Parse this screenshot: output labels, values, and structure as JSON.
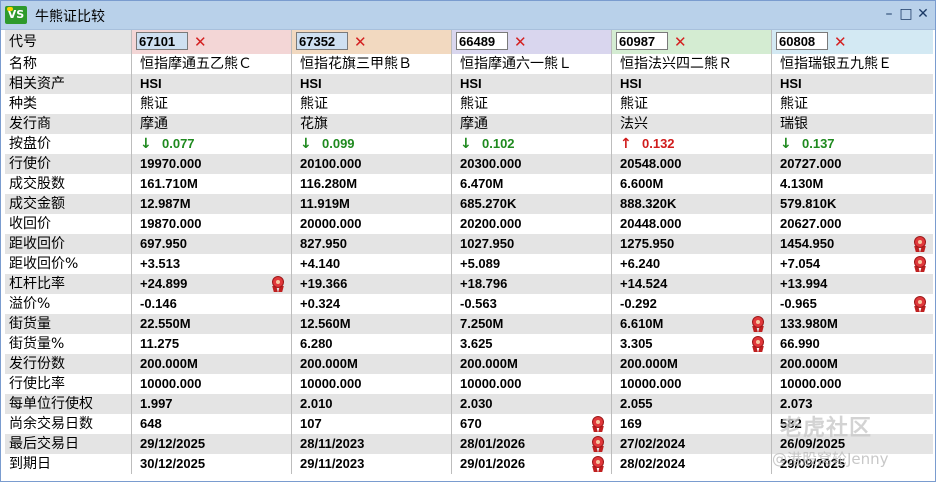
{
  "window": {
    "title": "牛熊证比较",
    "app_icon": "VS"
  },
  "labels": [
    "名称",
    "相关资产",
    "种类",
    "发行商",
    "按盘价",
    "行使价",
    "成交股数",
    "成交金额",
    "收回价",
    "距收回价",
    "距收回价%",
    "杠杆比率",
    "溢价%",
    "街货量",
    "街货量%",
    "发行份数",
    "行使比率",
    "每单位行使权",
    "尚余交易日数",
    "最后交易日",
    "到期日"
  ],
  "header_label": "代号",
  "colors": {
    "col0": "#f3d6d6",
    "col1": "#f2d9c0",
    "col2": "#d9d6ee",
    "col3": "#d4ecd2",
    "col4": "#d3e9f3"
  },
  "products": [
    {
      "code": "67101",
      "name": "恒指摩通五乙熊Ｃ",
      "asset": "HSI",
      "type": "熊证",
      "issuer": "摩通",
      "price": "0.077",
      "dir": "down",
      "vals": [
        "19970.000",
        "161.710M",
        "12.987M",
        "19870.000",
        "697.950",
        "+3.513",
        "+24.899",
        "-0.146",
        "22.550M",
        "11.275",
        "200.000M",
        "10000.000",
        "1.997",
        "648",
        "29/12/2025",
        "30/12/2025"
      ],
      "medals": [
        6
      ]
    },
    {
      "code": "67352",
      "name": "恒指花旗三甲熊Ｂ",
      "asset": "HSI",
      "type": "熊证",
      "issuer": "花旗",
      "price": "0.099",
      "dir": "down",
      "vals": [
        "20100.000",
        "116.280M",
        "11.919M",
        "20000.000",
        "827.950",
        "+4.140",
        "+19.366",
        "+0.324",
        "12.560M",
        "6.280",
        "200.000M",
        "10000.000",
        "2.010",
        "107",
        "28/11/2023",
        "29/11/2023"
      ],
      "medals": []
    },
    {
      "code": "66489",
      "name": "恒指摩通六一熊Ｌ",
      "asset": "HSI",
      "type": "熊证",
      "issuer": "摩通",
      "price": "0.102",
      "dir": "down",
      "vals": [
        "20300.000",
        "6.470M",
        "685.270K",
        "20200.000",
        "1027.950",
        "+5.089",
        "+18.796",
        "-0.563",
        "7.250M",
        "3.625",
        "200.000M",
        "10000.000",
        "2.030",
        "670",
        "28/01/2026",
        "29/01/2026"
      ],
      "medals": [
        13,
        14,
        15
      ]
    },
    {
      "code": "60987",
      "name": "恒指法兴四二熊Ｒ",
      "asset": "HSI",
      "type": "熊证",
      "issuer": "法兴",
      "price": "0.132",
      "dir": "up",
      "vals": [
        "20548.000",
        "6.600M",
        "888.320K",
        "20448.000",
        "1275.950",
        "+6.240",
        "+14.524",
        "-0.292",
        "6.610M",
        "3.305",
        "200.000M",
        "10000.000",
        "2.055",
        "169",
        "27/02/2024",
        "28/02/2024"
      ],
      "medals": [
        8,
        9
      ]
    },
    {
      "code": "60808",
      "name": "恒指瑞银五九熊Ｅ",
      "asset": "HSI",
      "type": "熊证",
      "issuer": "瑞银",
      "price": "0.137",
      "dir": "down",
      "vals": [
        "20727.000",
        "4.130M",
        "579.810K",
        "20627.000",
        "1454.950",
        "+7.054",
        "+13.994",
        "-0.965",
        "133.980M",
        "66.990",
        "200.000M",
        "10000.000",
        "2.073",
        "582",
        "26/09/2025",
        "29/09/2025"
      ],
      "medals": [
        4,
        5,
        7
      ]
    }
  ],
  "watermark": {
    "line1": "老虎社区",
    "line2": "@港股窝轮Jenny"
  }
}
